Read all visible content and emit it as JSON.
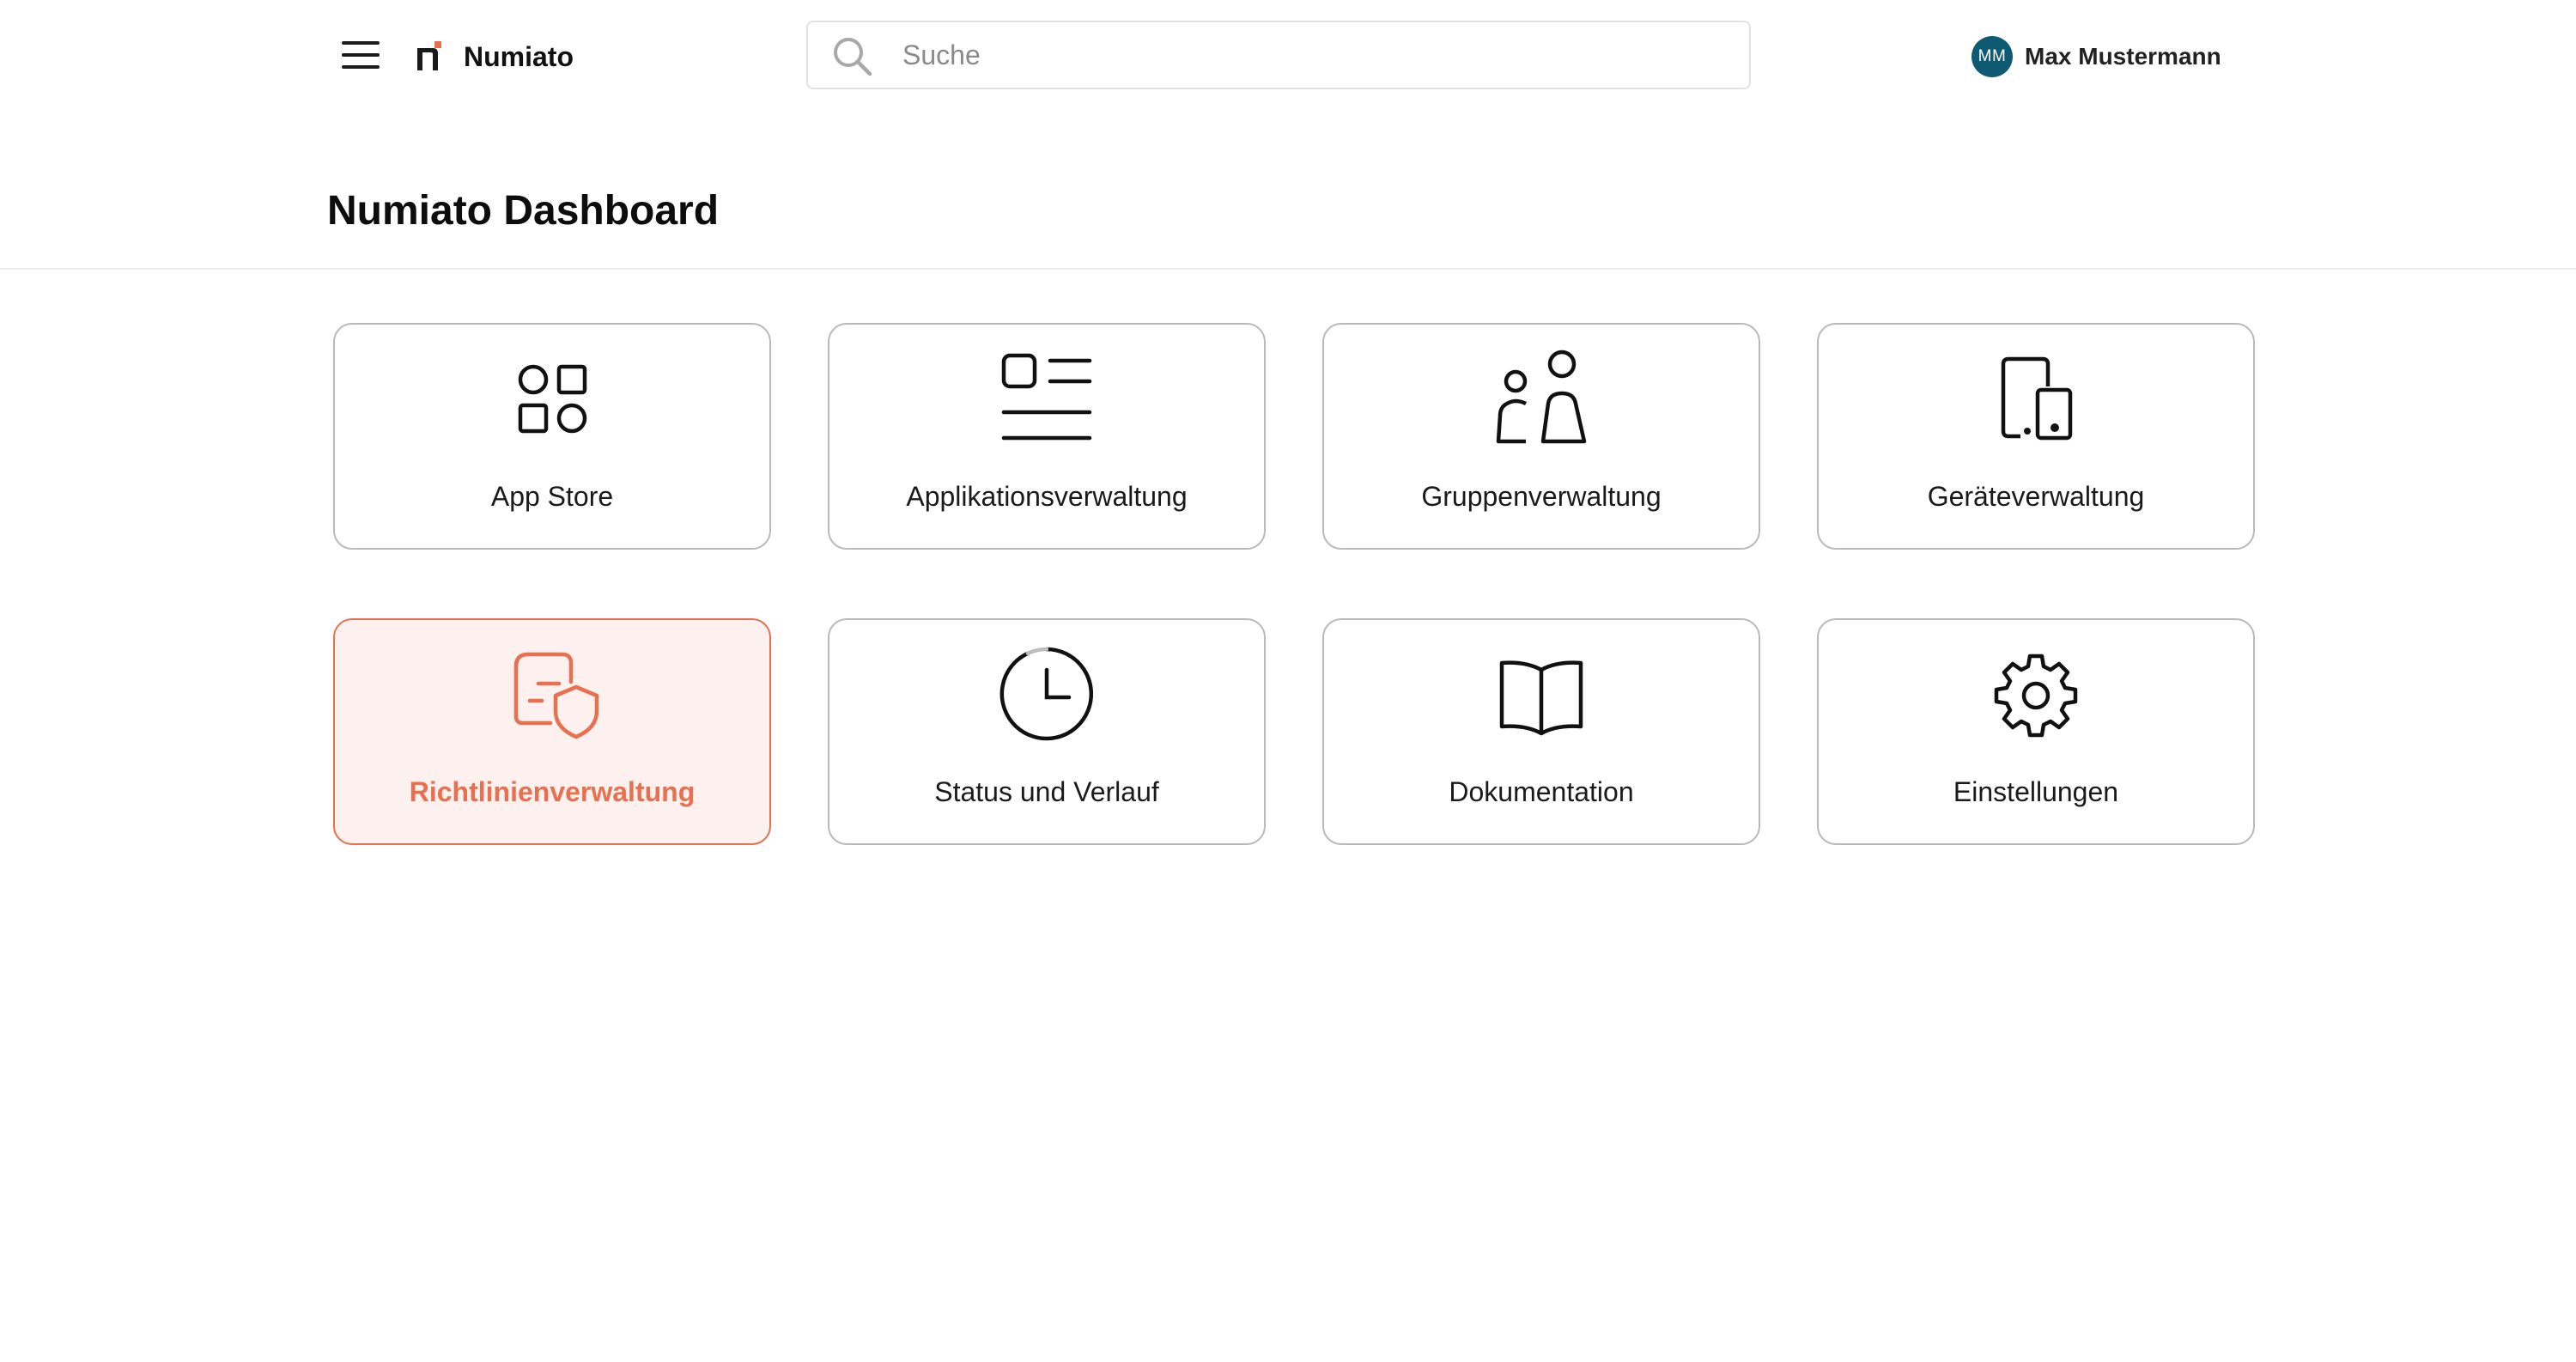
{
  "header": {
    "brand": "Numiato",
    "search_placeholder": "Suche",
    "search_value": "",
    "user": {
      "initials": "MM",
      "name": "Max Mustermann"
    }
  },
  "page": {
    "title": "Numiato Dashboard"
  },
  "colors": {
    "accent": "#e8704f",
    "avatar": "#0f5a73",
    "tile_border": "#b9b9b9",
    "active_bg": "#fcf1ef"
  },
  "tiles": [
    {
      "label": "App Store",
      "icon": "apps-grid-icon",
      "active": false
    },
    {
      "label": "Applikationsverwaltung",
      "icon": "list-icon",
      "active": false
    },
    {
      "label": "Gruppenverwaltung",
      "icon": "users-icon",
      "active": false
    },
    {
      "label": "Geräteverwaltung",
      "icon": "devices-icon",
      "active": false
    },
    {
      "label": "Richtlinienverwaltung",
      "icon": "policy-shield-icon",
      "active": true
    },
    {
      "label": "Status und Verlauf",
      "icon": "clock-icon",
      "active": false
    },
    {
      "label": "Dokumentation",
      "icon": "book-icon",
      "active": false
    },
    {
      "label": "Einstellungen",
      "icon": "gear-icon",
      "active": false
    }
  ]
}
